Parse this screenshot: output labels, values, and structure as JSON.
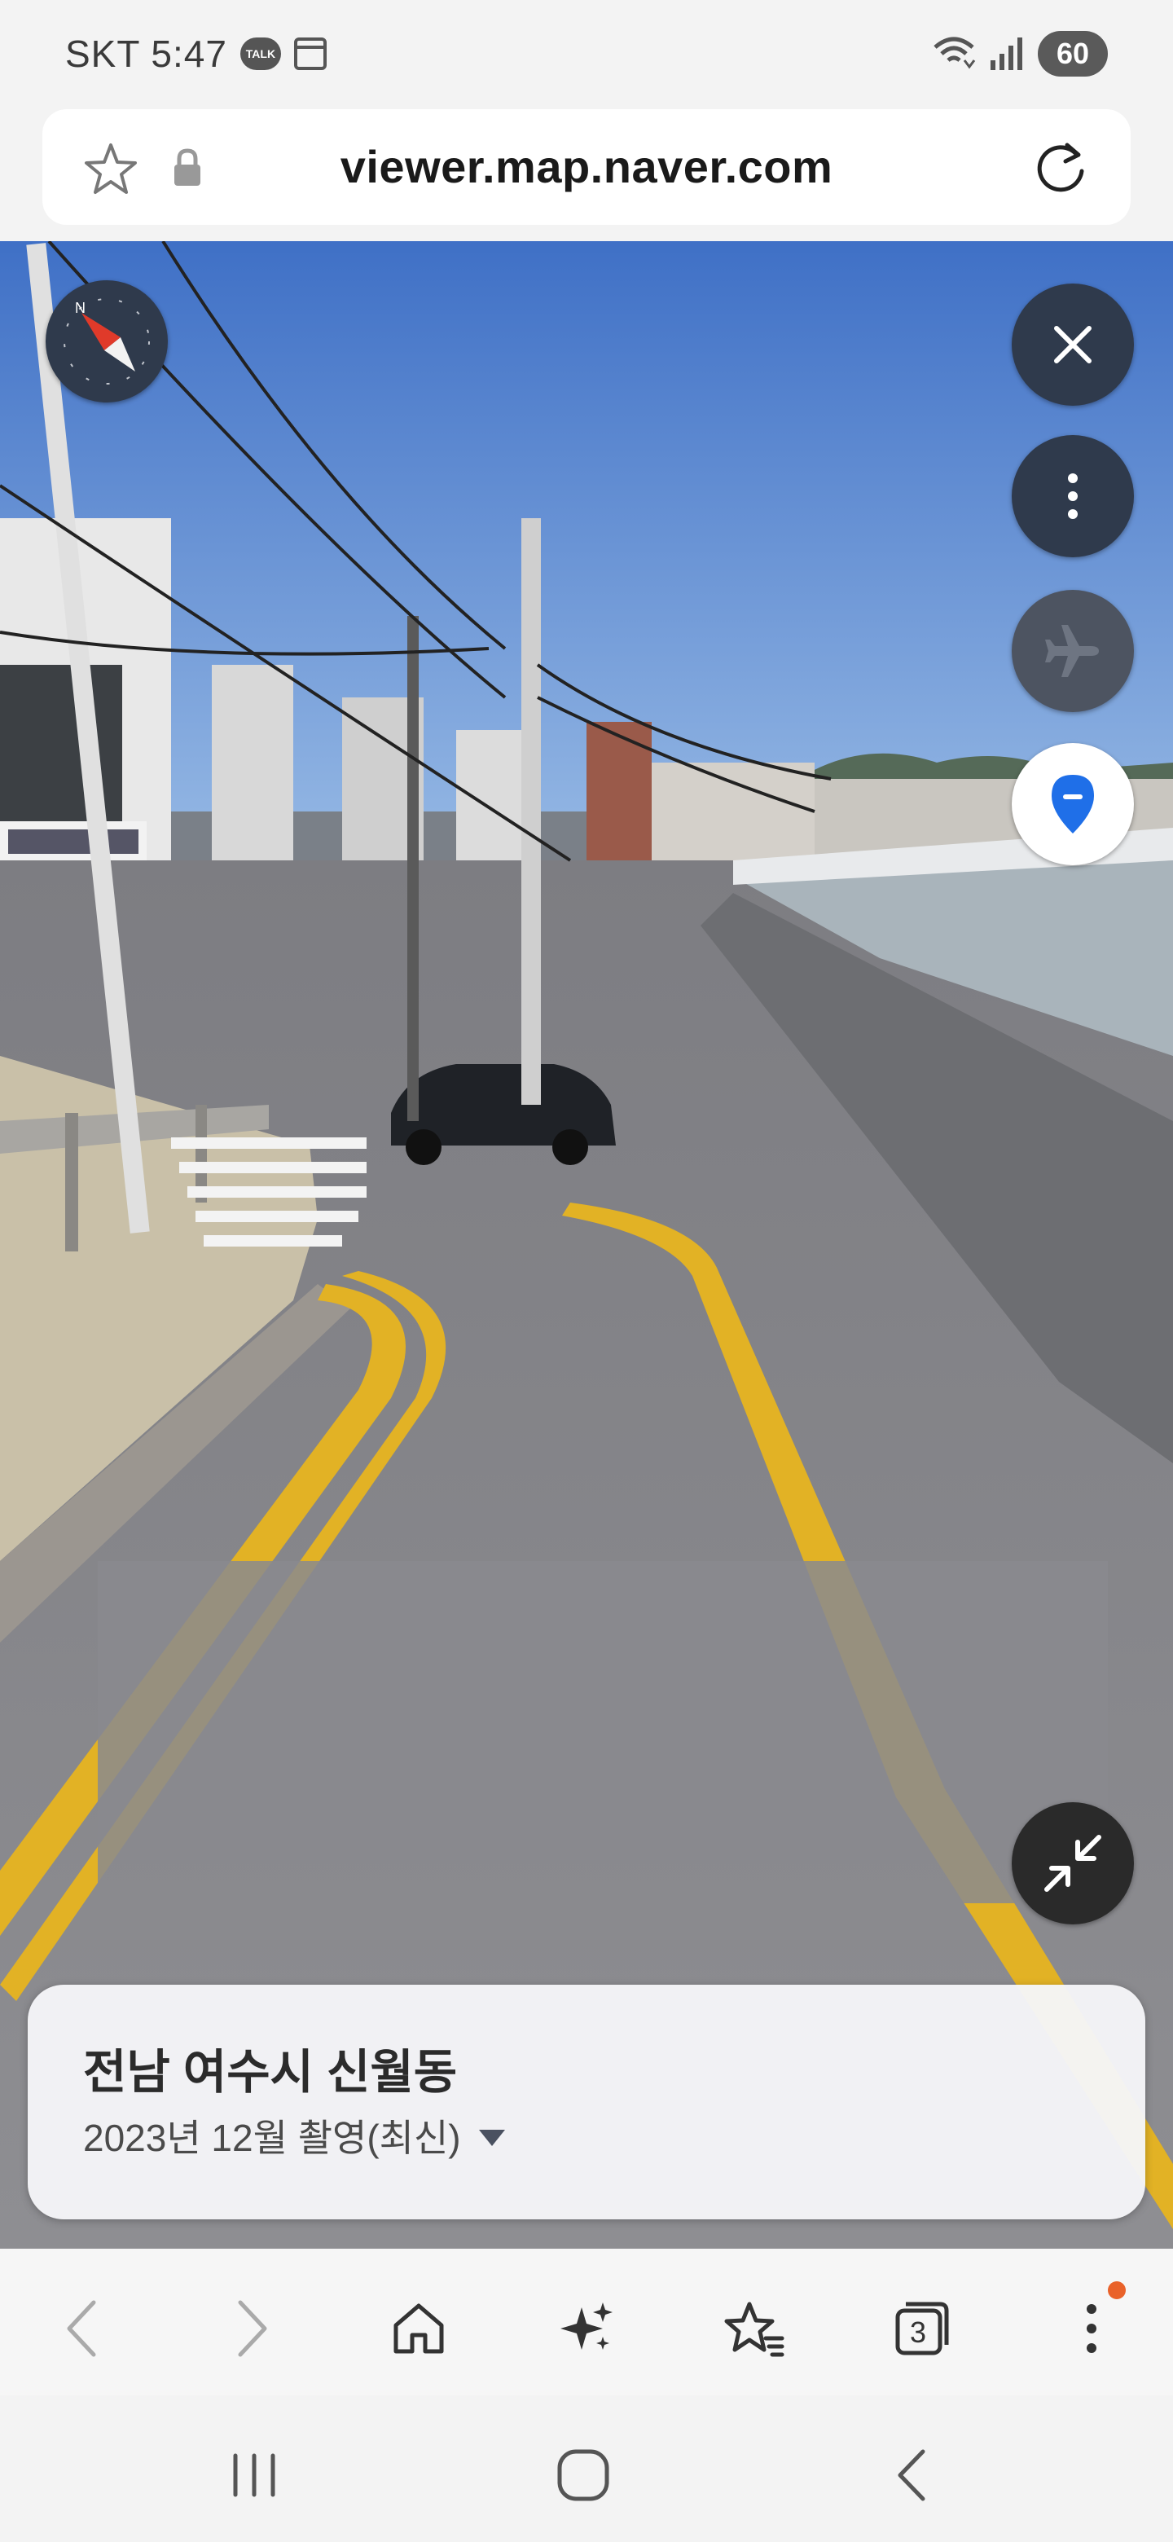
{
  "status_bar": {
    "carrier_time": "SKT 5:47",
    "talk_badge": "TALK",
    "battery": "60"
  },
  "browser": {
    "url": "viewer.map.naver.com"
  },
  "street_view": {
    "buttons": [
      "close",
      "more",
      "airplane-view",
      "location-pin",
      "shrink"
    ],
    "compass_label": "N"
  },
  "info_card": {
    "title": "전남 여수시 신월동",
    "date": "2023년 12월 촬영(최신)"
  },
  "toolbar": {
    "tabs_count": "3",
    "items": [
      "back",
      "forward",
      "home",
      "ai-features",
      "bookmarks",
      "tabs",
      "menu"
    ]
  },
  "colors": {
    "fab_dark": "#2f3a4c",
    "pin_blue": "#1f6fe8",
    "notification": "#e9622a",
    "sky": "#4a78c8",
    "road": "#8a8a8e",
    "lane_yellow": "#e2b225"
  }
}
